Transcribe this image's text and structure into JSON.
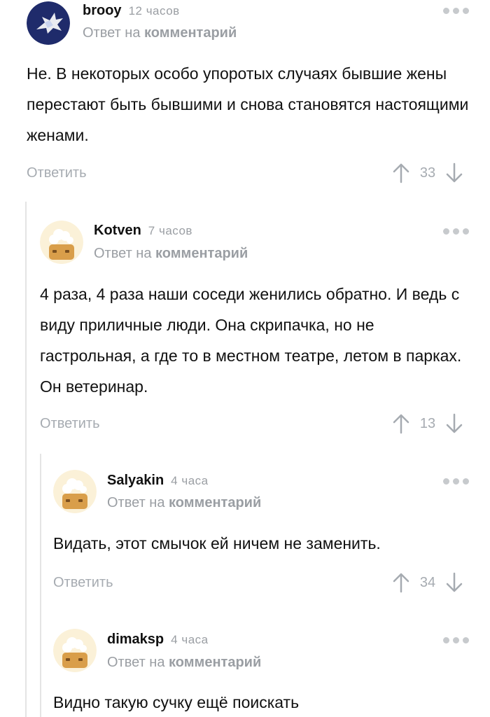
{
  "reply_to_label": "Ответ на",
  "reply_to_target": "комментарий",
  "reply_button_label": "Ответить",
  "comments": [
    {
      "author": "brooy",
      "time": "12 часов",
      "text": "Не. В некоторых особо упоротых случаях бывшие жены перестают быть бывшими и снова становятся настоящими женами.",
      "score": "33"
    },
    {
      "author": "Kotven",
      "time": "7 часов",
      "text": "4 раза, 4 раза наши соседи женились обратно. И ведь с виду приличные люди. Она скрипачка, но не гастрольная, а где то в местном театре, летом в парках. Он ветеринар.",
      "score": "13"
    },
    {
      "author": "Salyakin",
      "time": "4 часа",
      "text": "Видать, этот смычок ей ничем не заменить.",
      "score": "34"
    },
    {
      "author": "dimaksp",
      "time": "4 часа",
      "text": "Видно такую сучку ещё поискать"
    }
  ],
  "colors": {
    "text": "#111111",
    "muted": "#9a9ea3",
    "thread_line": "#e4e4e4",
    "avatar_navy": "#1f2b6b",
    "avatar_toast": "#f3d89c"
  },
  "icons": {
    "upvote": "arrow-up-icon",
    "downvote": "arrow-down-icon",
    "menu": "more-dots-icon"
  }
}
